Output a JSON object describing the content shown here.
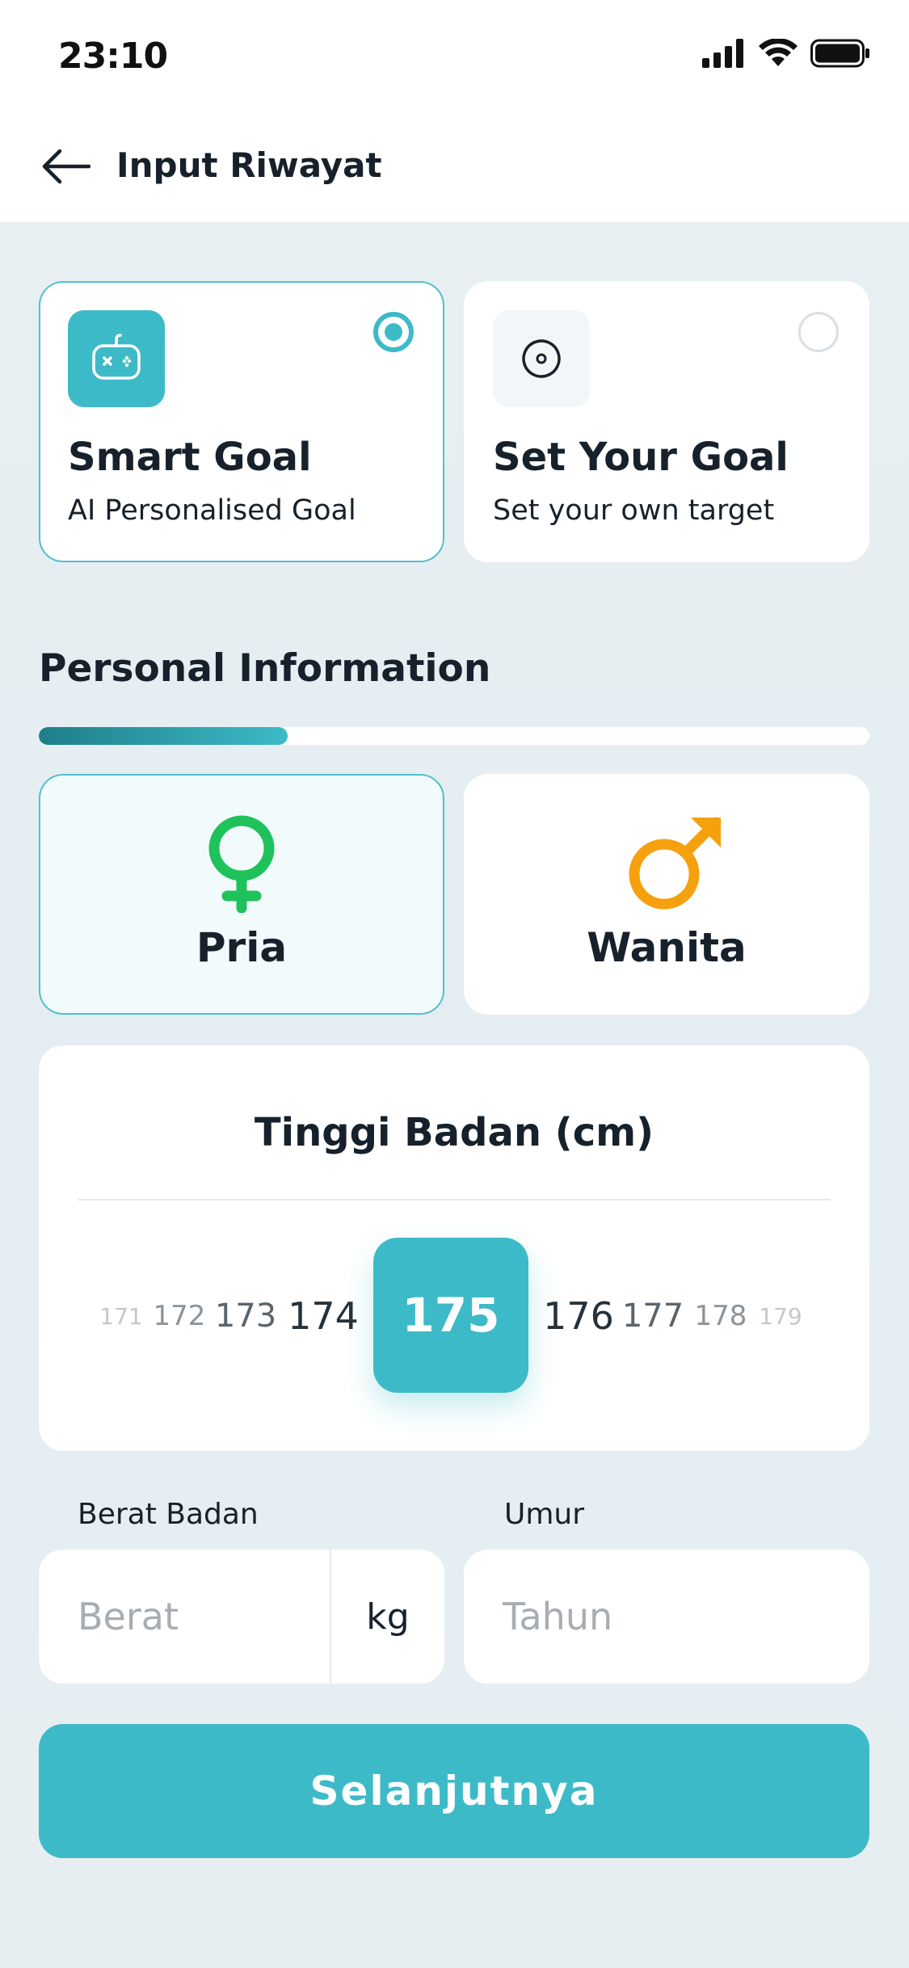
{
  "status_bar": {
    "time": "23:10"
  },
  "header": {
    "title": "Input Riwayat"
  },
  "goal_options": [
    {
      "title": "Smart Goal",
      "subtitle": "AI Personalised Goal",
      "icon": "gamepad-icon",
      "selected": true
    },
    {
      "title": "Set Your Goal",
      "subtitle": "Set your own target",
      "icon": "target-icon",
      "selected": false
    }
  ],
  "section": {
    "title": "Personal Information",
    "progress": 0.3
  },
  "gender_options": [
    {
      "label": "Pria",
      "icon": "female-symbol-icon",
      "icon_color": "#1fc25a",
      "selected": true
    },
    {
      "label": "Wanita",
      "icon": "male-symbol-icon",
      "icon_color": "#f5a10d",
      "selected": false
    }
  ],
  "height": {
    "title": "Tinggi Badan (cm)",
    "values": [
      "171",
      "172",
      "173",
      "174",
      "175",
      "176",
      "177",
      "178",
      "179"
    ],
    "selected": "175"
  },
  "weight": {
    "label": "Berat Badan",
    "placeholder": "Berat",
    "unit": "kg"
  },
  "age": {
    "label": "Umur",
    "placeholder": "Tahun"
  },
  "next_button": {
    "label": "Selanjutnya"
  },
  "colors": {
    "accent": "#3dbac7",
    "accent_dark": "#1e7f8a",
    "text": "#17212b"
  }
}
